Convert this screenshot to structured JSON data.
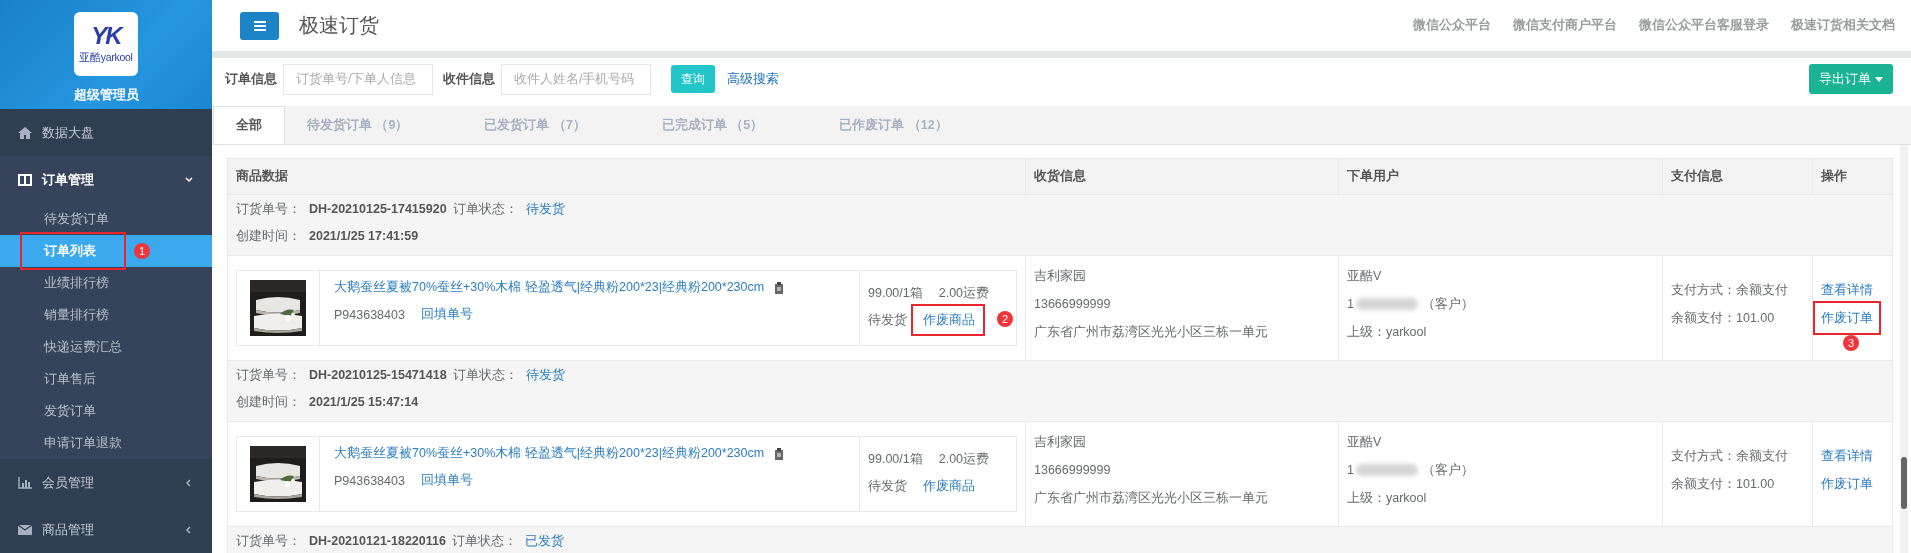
{
  "sidebar": {
    "logo": {
      "mark": "YK",
      "caption": "亚酷yarkool"
    },
    "role": "超级管理员",
    "menu": [
      {
        "label": "数据大盘",
        "kind": "link"
      },
      {
        "label": "订单管理",
        "kind": "group",
        "expanded": true,
        "children": [
          {
            "label": "待发货订单",
            "selected": false
          },
          {
            "label": "订单列表",
            "selected": true,
            "annotation": "1"
          },
          {
            "label": "业绩排行榜",
            "selected": false
          },
          {
            "label": "销量排行榜",
            "selected": false
          },
          {
            "label": "快递运费汇总",
            "selected": false
          },
          {
            "label": "订单售后",
            "selected": false
          },
          {
            "label": "发货订单",
            "selected": false
          },
          {
            "label": "申请订单退款",
            "selected": false
          }
        ]
      },
      {
        "label": "会员管理",
        "kind": "group",
        "expanded": false
      },
      {
        "label": "商品管理",
        "kind": "group",
        "expanded": false
      }
    ]
  },
  "header": {
    "title": "极速订货",
    "links": [
      "微信公众平台",
      "微信支付商户平台",
      "微信公众平台客服登录",
      "极速订货相关文档"
    ]
  },
  "filter": {
    "fields": [
      {
        "label": "订单信息",
        "placeholder": "订货单号/下单人信息"
      },
      {
        "label": "收件信息",
        "placeholder": "收件人姓名/手机号码"
      }
    ],
    "search_button": "查询",
    "advanced_link": "高级搜索",
    "export_button": "导出订单"
  },
  "tabs": [
    {
      "label": "全部",
      "selected": true
    },
    {
      "label": "待发货订单",
      "count": "（9）",
      "selected": false
    },
    {
      "label": "已发货订单",
      "count": "（7）",
      "selected": false
    },
    {
      "label": "已完成订单",
      "count": "（5）",
      "selected": false
    },
    {
      "label": "已作废订单",
      "count": "（12）",
      "selected": false
    }
  ],
  "table": {
    "columns": [
      "商品数据",
      "收货信息",
      "下单用户",
      "支付信息",
      "操作"
    ],
    "orders": [
      {
        "order_no_label": "订货单号：",
        "order_no": "DH-20210125-17415920",
        "status_label": "订单状态：",
        "status": "待发货",
        "created_label": "创建时间：",
        "created": "2021/1/25 17:41:59",
        "product": {
          "kind": "picture",
          "name": "大鹅蚕丝夏被70%蚕丝+30%木棉 轻盈透气|经典粉200*23|经典粉200*230cm",
          "sku": "P943638403",
          "fill_link": "回填单号",
          "price": "99.00/1箱",
          "shipping": "2.00运费",
          "item_status": "待发货",
          "void_link": "作废商品",
          "annotation": "2"
        },
        "receiver": {
          "name": "吉利家园",
          "phone": "13666999999",
          "address": "广东省广州市荔湾区光光小区三栋一单元"
        },
        "user": {
          "name": "亚酷V",
          "phone_start": "1",
          "phone_suffix": "（客户）",
          "superior": "上级：yarkool"
        },
        "payment": {
          "method": "支付方式：余额支付",
          "amount": "余额支付：101.00"
        },
        "actions": [
          {
            "label": "查看详情"
          },
          {
            "label": "作废订单",
            "annotation": "3"
          }
        ]
      },
      {
        "order_no_label": "订货单号：",
        "order_no": "DH-20210125-15471418",
        "status_label": "订单状态：",
        "status": "待发货",
        "created_label": "创建时间：",
        "created": "2021/1/25 15:47:14",
        "product": {
          "kind": "picture",
          "name": "大鹅蚕丝夏被70%蚕丝+30%木棉 轻盈透气|经典粉200*23|经典粉200*230cm",
          "sku": "P943638403",
          "fill_link": "回填单号",
          "price": "99.00/1箱",
          "shipping": "2.00运费",
          "item_status": "待发货",
          "void_link": "作废商品"
        },
        "receiver": {
          "name": "吉利家园",
          "phone": "13666999999",
          "address": "广东省广州市荔湾区光光小区三栋一单元"
        },
        "user": {
          "name": "亚酷V",
          "phone_start": "1",
          "phone_suffix": "（客户）",
          "superior": "上级：yarkool"
        },
        "payment": {
          "method": "支付方式：余额支付",
          "amount": "余额支付：101.00"
        },
        "actions": [
          {
            "label": "查看详情"
          },
          {
            "label": "作废订单"
          }
        ]
      },
      {
        "order_no_label": "订货单号：",
        "order_no": "DH-20210121-18220116",
        "status_label": "订单状态：",
        "status": "已发货"
      }
    ]
  }
}
